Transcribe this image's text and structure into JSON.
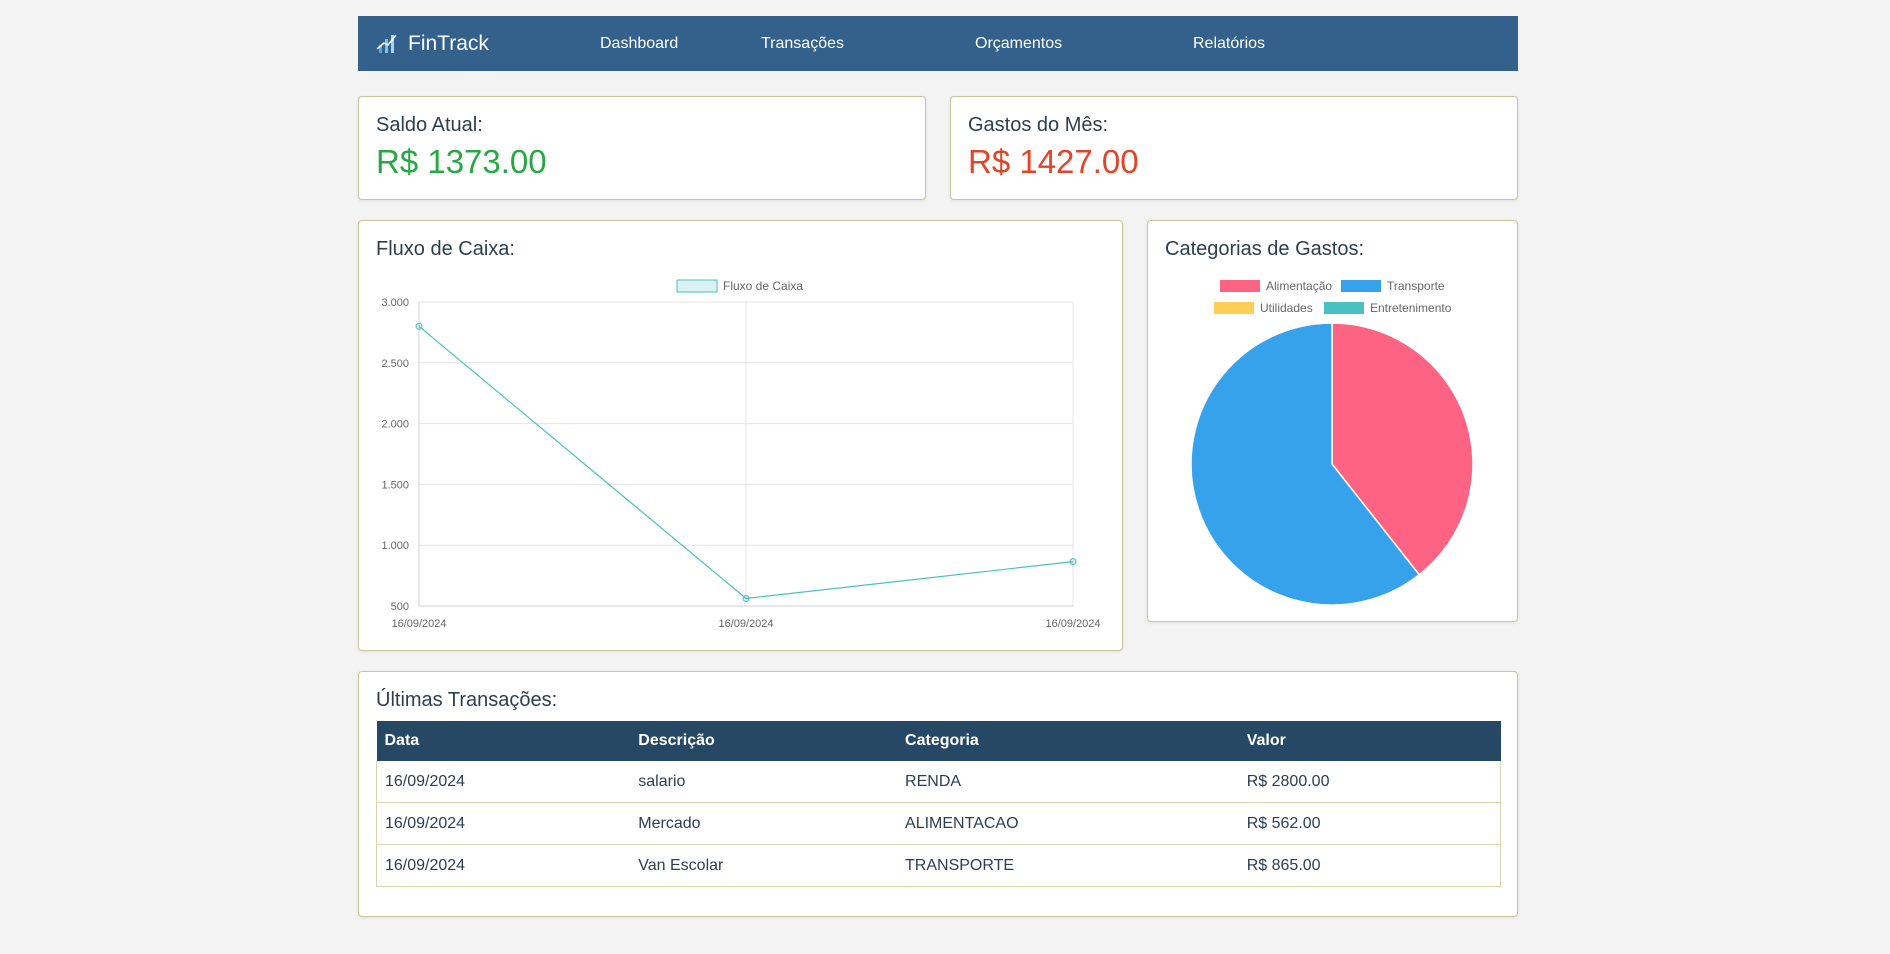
{
  "nav": {
    "brand": "FinTrack",
    "links": [
      "Dashboard",
      "Transações",
      "Orçamentos",
      "Relatórios"
    ]
  },
  "saldo": {
    "label": "Saldo Atual:",
    "value": "R$ 1373.00",
    "color": "#28a745"
  },
  "gastos": {
    "label": "Gastos do Mês:",
    "value": "R$ 1427.00",
    "color": "#e0452a"
  },
  "fluxo": {
    "title": "Fluxo de Caixa:"
  },
  "categorias": {
    "title": "Categorias de Gastos:"
  },
  "transacoes": {
    "title": "Últimas Transações:",
    "headers": [
      "Data",
      "Descrição",
      "Categoria",
      "Valor"
    ],
    "rows": [
      [
        "16/09/2024",
        "salario",
        "RENDA",
        "R$ 2800.00"
      ],
      [
        "16/09/2024",
        "Mercado",
        "ALIMENTACAO",
        "R$ 562.00"
      ],
      [
        "16/09/2024",
        "Van Escolar",
        "TRANSPORTE",
        "R$ 865.00"
      ]
    ]
  },
  "chart_data": [
    {
      "type": "line",
      "title": "",
      "x": [
        "16/09/2024",
        "16/09/2024",
        "16/09/2024"
      ],
      "series": [
        {
          "name": "Fluxo de Caixa",
          "values": [
            2800,
            562,
            865
          ],
          "color": "#4bc0c0"
        }
      ],
      "ylim": [
        500,
        3000
      ],
      "yticks": [
        "3.000",
        "2.500",
        "2.000",
        "1.500",
        "1.000",
        "500"
      ],
      "ytick_values": [
        3000,
        2500,
        2000,
        1500,
        1000,
        500
      ],
      "grid": true,
      "legend": "top"
    },
    {
      "type": "pie",
      "title": "",
      "categories": [
        "Alimentação",
        "Transporte",
        "Utilidades",
        "Entretenimento"
      ],
      "values": [
        562,
        865,
        0,
        0
      ],
      "colors": [
        "#ff6384",
        "#36a2eb",
        "#ffce56",
        "#4bc0c0"
      ],
      "legend": "top"
    }
  ]
}
